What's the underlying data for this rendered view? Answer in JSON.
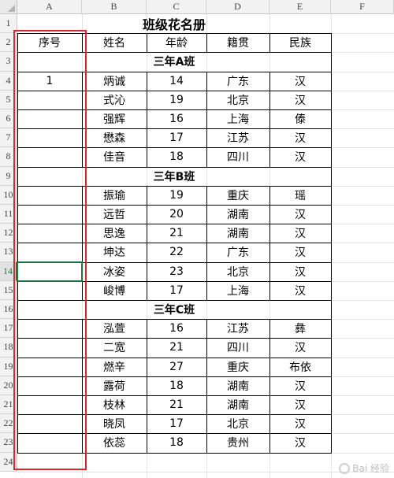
{
  "columns": [
    "A",
    "B",
    "C",
    "D",
    "E",
    "F"
  ],
  "row_numbers": [
    "1",
    "2",
    "3",
    "4",
    "5",
    "6",
    "7",
    "8",
    "9",
    "10",
    "11",
    "12",
    "13",
    "14",
    "15",
    "16",
    "17",
    "18",
    "19",
    "20",
    "21",
    "22",
    "23",
    "24"
  ],
  "active_row": "14",
  "title": "班级花名册",
  "headers": [
    "序号",
    "姓名",
    "年龄",
    "籍贯",
    "民族"
  ],
  "sections": [
    {
      "name": "三年A班",
      "rows": [
        {
          "seq": "1",
          "name": "炳诚",
          "age": "14",
          "origin": "广东",
          "ethnicity": "汉"
        },
        {
          "seq": "",
          "name": "式沁",
          "age": "19",
          "origin": "北京",
          "ethnicity": "汉"
        },
        {
          "seq": "",
          "name": "强辉",
          "age": "16",
          "origin": "上海",
          "ethnicity": "傣"
        },
        {
          "seq": "",
          "name": "懋森",
          "age": "17",
          "origin": "江苏",
          "ethnicity": "汉"
        },
        {
          "seq": "",
          "name": "佳音",
          "age": "18",
          "origin": "四川",
          "ethnicity": "汉"
        }
      ]
    },
    {
      "name": "三年B班",
      "rows": [
        {
          "seq": "",
          "name": "振瑜",
          "age": "19",
          "origin": "重庆",
          "ethnicity": "瑶"
        },
        {
          "seq": "",
          "name": "远哲",
          "age": "20",
          "origin": "湖南",
          "ethnicity": "汉"
        },
        {
          "seq": "",
          "name": "思逸",
          "age": "21",
          "origin": "湖南",
          "ethnicity": "汉"
        },
        {
          "seq": "",
          "name": "坤达",
          "age": "22",
          "origin": "广东",
          "ethnicity": "汉"
        },
        {
          "seq": "",
          "name": "冰姿",
          "age": "23",
          "origin": "北京",
          "ethnicity": "汉"
        },
        {
          "seq": "",
          "name": "峻博",
          "age": "17",
          "origin": "上海",
          "ethnicity": "汉"
        }
      ]
    },
    {
      "name": "三年C班",
      "rows": [
        {
          "seq": "",
          "name": "泓萱",
          "age": "16",
          "origin": "江苏",
          "ethnicity": "彝"
        },
        {
          "seq": "",
          "name": "二宽",
          "age": "21",
          "origin": "四川",
          "ethnicity": "汉"
        },
        {
          "seq": "",
          "name": "燃辛",
          "age": "27",
          "origin": "重庆",
          "ethnicity": "布依"
        },
        {
          "seq": "",
          "name": "露荷",
          "age": "18",
          "origin": "湖南",
          "ethnicity": "汉"
        },
        {
          "seq": "",
          "name": "枝林",
          "age": "21",
          "origin": "湖南",
          "ethnicity": "汉"
        },
        {
          "seq": "",
          "name": "晓凤",
          "age": "17",
          "origin": "北京",
          "ethnicity": "汉"
        },
        {
          "seq": "",
          "name": "依蕊",
          "age": "18",
          "origin": "贵州",
          "ethnicity": "汉"
        }
      ]
    }
  ],
  "watermark": "Bai 经验",
  "colors": {
    "selection": "#217346",
    "highlight_box": "#e0262a",
    "gridline": "#e3e3e3",
    "header_bg": "#f2f2f2"
  }
}
